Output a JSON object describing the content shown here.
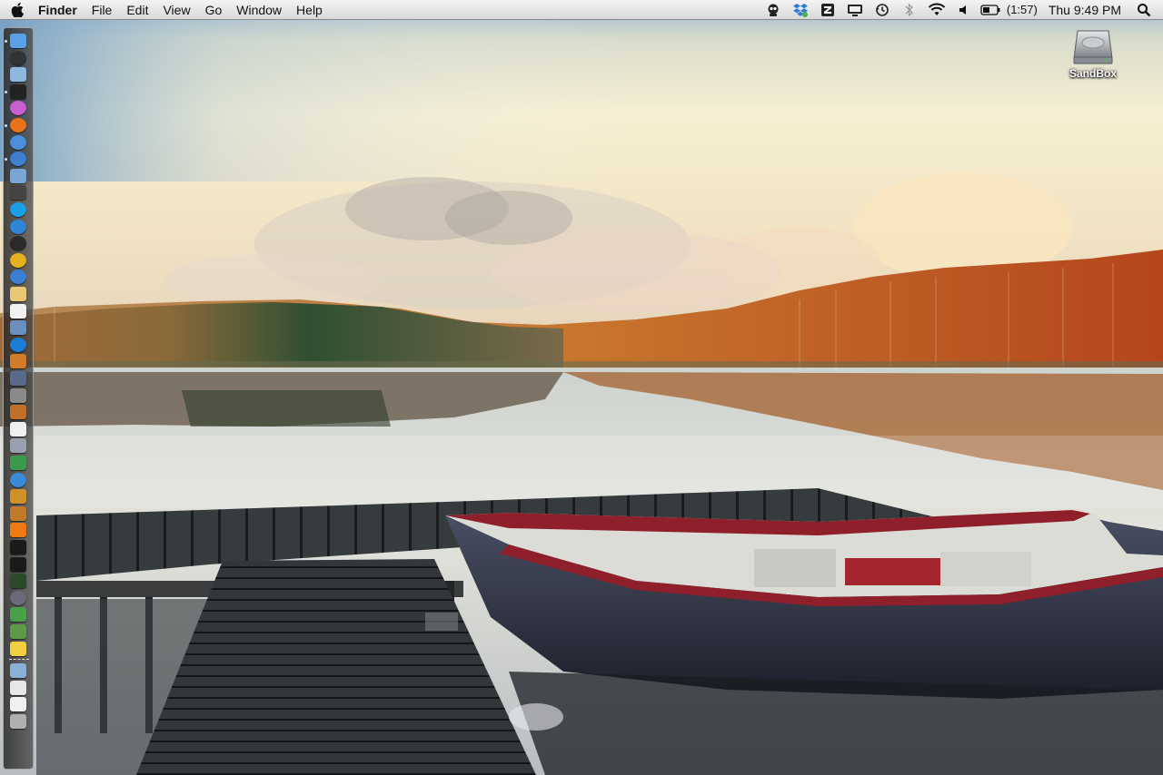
{
  "menubar": {
    "apple_icon": "apple-icon",
    "app_name": "Finder",
    "menus": [
      "File",
      "Edit",
      "View",
      "Go",
      "Window",
      "Help"
    ],
    "status": {
      "battery_time": "(1:57)",
      "clock": "Thu 9:49 PM",
      "icons": [
        "menu-extra-icon",
        "dropbox-icon",
        "app-menu-icon",
        "display-icon",
        "time-machine-icon",
        "bluetooth-icon",
        "wifi-icon",
        "volume-icon",
        "battery-icon",
        "spotlight-icon"
      ]
    }
  },
  "desktop": {
    "drive": {
      "label": "SandBox",
      "icon": "hard-drive-icon"
    }
  },
  "dock": {
    "position": "left",
    "icons": [
      {
        "name": "finder",
        "color": "#5aa0e6"
      },
      {
        "name": "dashboard",
        "color": "#333333"
      },
      {
        "name": "preview",
        "color": "#8fb8e0"
      },
      {
        "name": "app-black",
        "color": "#222222"
      },
      {
        "name": "itunes",
        "color": "#c85fd0"
      },
      {
        "name": "firefox",
        "color": "#e8731a"
      },
      {
        "name": "safari",
        "color": "#4b8fd8"
      },
      {
        "name": "xcode",
        "color": "#3f7fd0"
      },
      {
        "name": "screen-sharing",
        "color": "#7aa6d6"
      },
      {
        "name": "photo-booth",
        "color": "#444444"
      },
      {
        "name": "skype",
        "color": "#1a9ee6"
      },
      {
        "name": "dropbox",
        "color": "#2e86d4"
      },
      {
        "name": "app-dark",
        "color": "#2a2a2a"
      },
      {
        "name": "chrome",
        "color": "#e6b020"
      },
      {
        "name": "facetime",
        "color": "#3a7fd4"
      },
      {
        "name": "notes",
        "color": "#e8c872"
      },
      {
        "name": "ical",
        "color": "#f2f2f2"
      },
      {
        "name": "address-book",
        "color": "#6b8fbf"
      },
      {
        "name": "app-store",
        "color": "#1d7ed8"
      },
      {
        "name": "iphoto",
        "color": "#d07a2a"
      },
      {
        "name": "mission-control",
        "color": "#5a6a8a"
      },
      {
        "name": "system-preferences",
        "color": "#8a8a8a"
      },
      {
        "name": "cyberduck",
        "color": "#c0702a"
      },
      {
        "name": "textedit",
        "color": "#f0f0f0"
      },
      {
        "name": "script-editor",
        "color": "#9aa0b0"
      },
      {
        "name": "chart-app",
        "color": "#3a9a4a"
      },
      {
        "name": "utility-blue",
        "color": "#3a8ad8"
      },
      {
        "name": "guitar",
        "color": "#d0902a"
      },
      {
        "name": "sequel",
        "color": "#c07a2a"
      },
      {
        "name": "vlc",
        "color": "#f07a10"
      },
      {
        "name": "quicktime",
        "color": "#1a1a1a"
      },
      {
        "name": "terminal",
        "color": "#1a1a1a"
      },
      {
        "name": "activity-monitor",
        "color": "#2a4a2a"
      },
      {
        "name": "osx-icon",
        "color": "#6a6a7a"
      },
      {
        "name": "image-capture",
        "color": "#4aa04a"
      },
      {
        "name": "photos",
        "color": "#5a9a4a"
      },
      {
        "name": "stickies",
        "color": "#f0d040"
      },
      {
        "name": "applications-folder",
        "color": "#8ab0d8"
      },
      {
        "name": "documents",
        "color": "#e8e8e8"
      },
      {
        "name": "downloads",
        "color": "#f0f0f0"
      },
      {
        "name": "trash",
        "color": "#b0b0b0"
      }
    ]
  }
}
